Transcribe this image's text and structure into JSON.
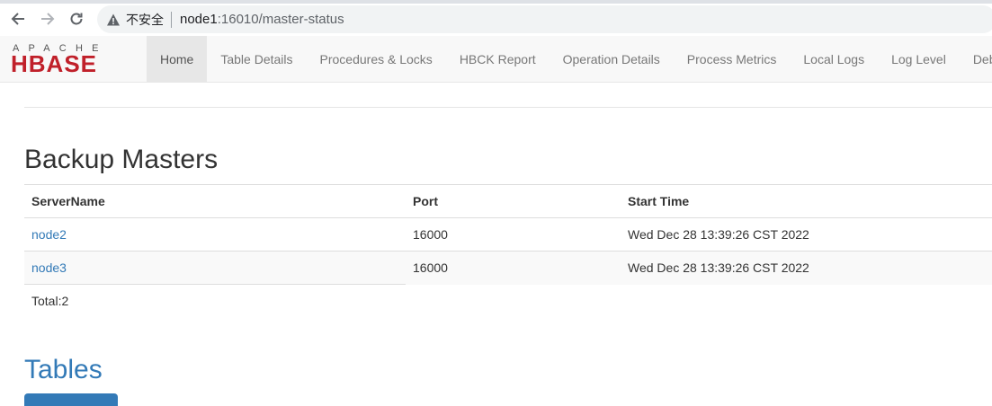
{
  "browser": {
    "security_label": "不安全",
    "url_host": "node1",
    "url_path": ":16010/master-status",
    "icons": [
      "back-arrow-icon",
      "forward-arrow-icon",
      "reload-icon",
      "warning-triangle-icon"
    ]
  },
  "navbar": {
    "logo_top": "APACHE",
    "logo_main": "HBASE",
    "tabs": [
      {
        "label": "Home",
        "active": true
      },
      {
        "label": "Table Details"
      },
      {
        "label": "Procedures & Locks"
      },
      {
        "label": "HBCK Report"
      },
      {
        "label": "Operation Details"
      },
      {
        "label": "Process Metrics"
      },
      {
        "label": "Local Logs"
      },
      {
        "label": "Log Level"
      },
      {
        "label": "Deb"
      }
    ]
  },
  "backup_masters": {
    "title": "Backup Masters",
    "columns": [
      "ServerName",
      "Port",
      "Start Time"
    ],
    "rows": [
      {
        "server": "node2",
        "port": "16000",
        "start_time": "Wed Dec 28 13:39:26 CST 2022"
      },
      {
        "server": "node3",
        "port": "16000",
        "start_time": "Wed Dec 28 13:39:26 CST 2022"
      }
    ],
    "total": "Total:2"
  },
  "tables_section": {
    "title": "Tables"
  },
  "colors": {
    "link": "#337ab7",
    "brand_red": "#c0202a",
    "navbar_bg": "#f8f8f8"
  }
}
